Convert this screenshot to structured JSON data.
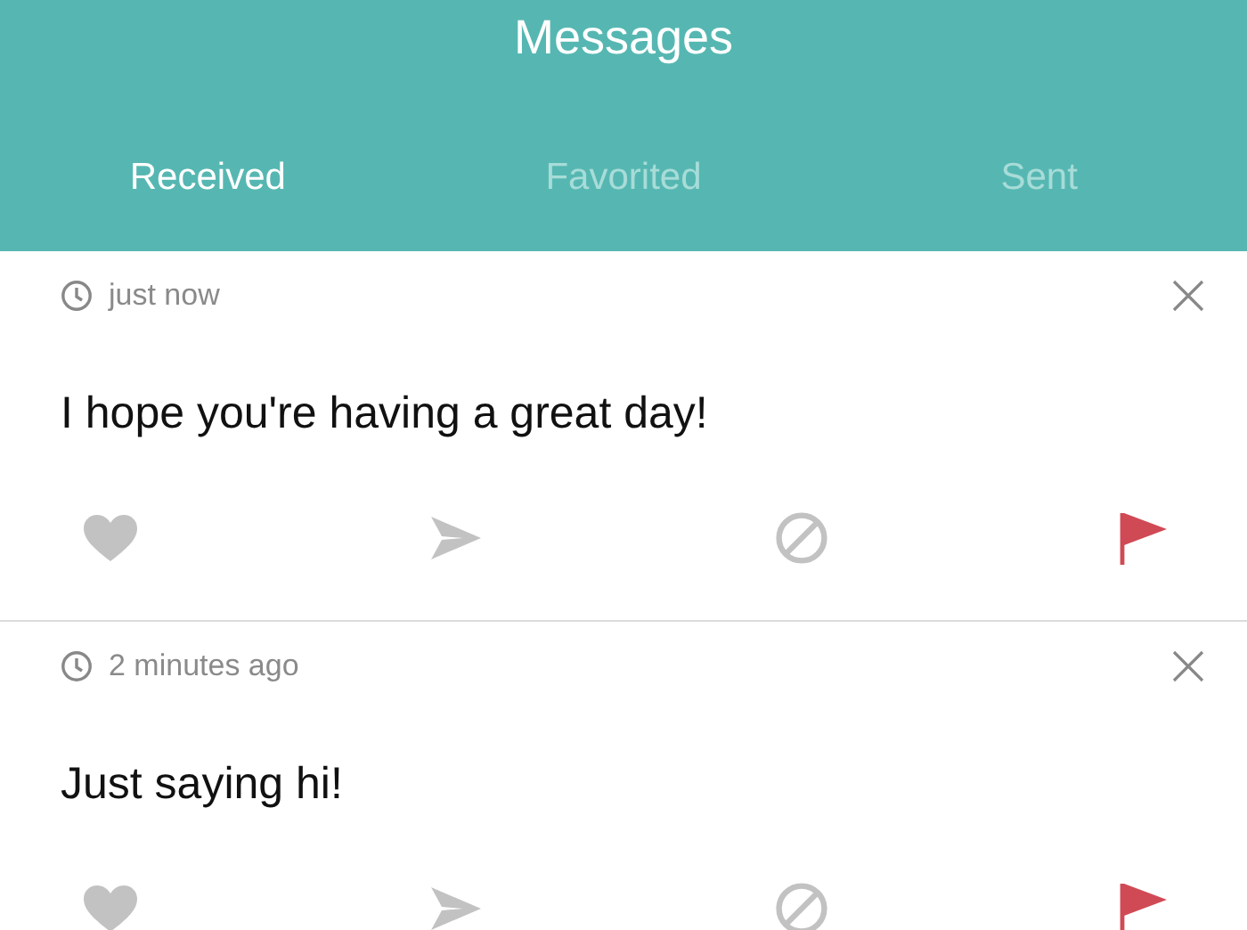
{
  "header": {
    "title": "Messages"
  },
  "tabs": [
    {
      "label": "Received",
      "selected": true
    },
    {
      "label": "Favorited",
      "selected": false
    },
    {
      "label": "Sent",
      "selected": false
    }
  ],
  "messages": [
    {
      "time": "just now",
      "text": "I hope you're having a great day!"
    },
    {
      "time": "2 minutes ago",
      "text": "Just saying hi!"
    }
  ]
}
